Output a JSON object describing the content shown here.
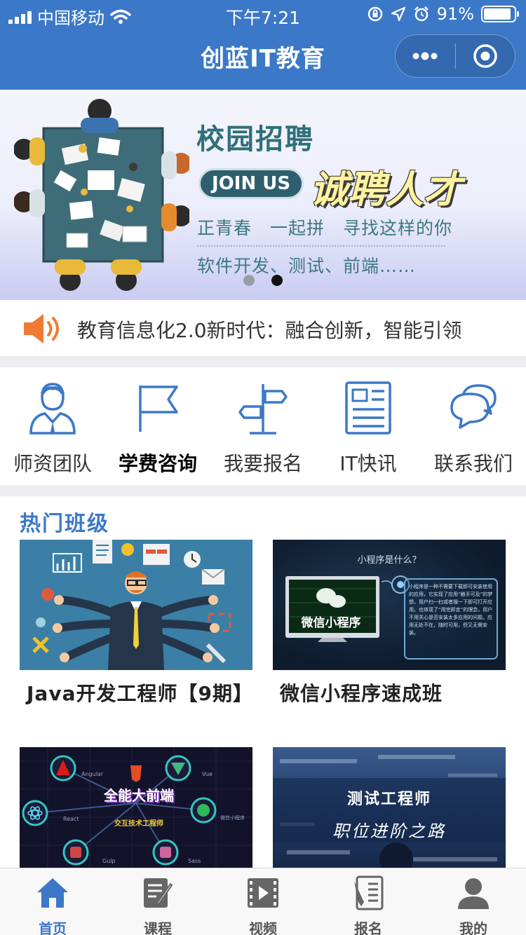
{
  "status_bar": {
    "carrier": "中国移动",
    "time": "下午7:21",
    "battery_percent": "91%",
    "battery_level": 0.91
  },
  "nav": {
    "title": "创蓝IT教育",
    "more_icon": "more-dots-icon",
    "close_icon": "target-close-icon"
  },
  "banner": {
    "heading": "校园招聘",
    "badge": "JOIN US",
    "slogan": "诚聘人才",
    "line1": "正青春　一起拼　寻找这样的你",
    "line2": "软件开发、测试、前端……",
    "slide_count": 2,
    "active_slide": 2
  },
  "notice": {
    "icon": "speaker-icon",
    "text": "教育信息化2.0新时代：融合创新，智能引领"
  },
  "menu": {
    "items": [
      {
        "label": "师资团队",
        "icon": "teacher-icon"
      },
      {
        "label": "学费咨询",
        "icon": "flag-icon"
      },
      {
        "label": "我要报名",
        "icon": "signpost-icon"
      },
      {
        "label": "IT快讯",
        "icon": "newspaper-icon"
      },
      {
        "label": "联系我们",
        "icon": "chat-bubbles-icon"
      }
    ]
  },
  "hot": {
    "title": "热门班级",
    "cards": [
      {
        "title": "Java开发工程师【9期】",
        "image": "java-engineer-illustration"
      },
      {
        "title": "微信小程序速成班",
        "image": "wechat-miniprogram-screen",
        "img_heading": "小程序是什么？",
        "img_caption": "微信小程序",
        "img_text": "小程序是一种不需要下载即可安装使用的应用，它实现了应用“触手可及”的梦想，用户扫一扫或者搜一下即可打开应用。也体现了“用完即走”的理念，用户不用关心是否安装太多应用的问题。应用无处不在，随时可用，但又无需安装。"
      },
      {
        "title": "",
        "image": "frontend-tech-graphic",
        "img_heading": "全能大前端",
        "img_sub": "交互技术工程师",
        "nodes": [
          "Angular",
          "Vue",
          "React",
          "微信小程序",
          "Gulp",
          "Sass"
        ]
      },
      {
        "title": "",
        "image": "test-engineer-graphic",
        "img_heading": "测试工程师",
        "img_sub": "职位进阶之路"
      }
    ]
  },
  "tabbar": {
    "active": "home",
    "items": [
      {
        "key": "home",
        "label": "首页",
        "icon": "home-icon"
      },
      {
        "key": "course",
        "label": "课程",
        "icon": "notebook-pen-icon"
      },
      {
        "key": "video",
        "label": "视频",
        "icon": "film-icon"
      },
      {
        "key": "signup",
        "label": "报名",
        "icon": "signup-form-icon"
      },
      {
        "key": "mine",
        "label": "我的",
        "icon": "user-icon"
      }
    ]
  },
  "colors": {
    "primary": "#3c78c8",
    "banner_text": "#3f7884",
    "speaker": "#f07a33"
  }
}
